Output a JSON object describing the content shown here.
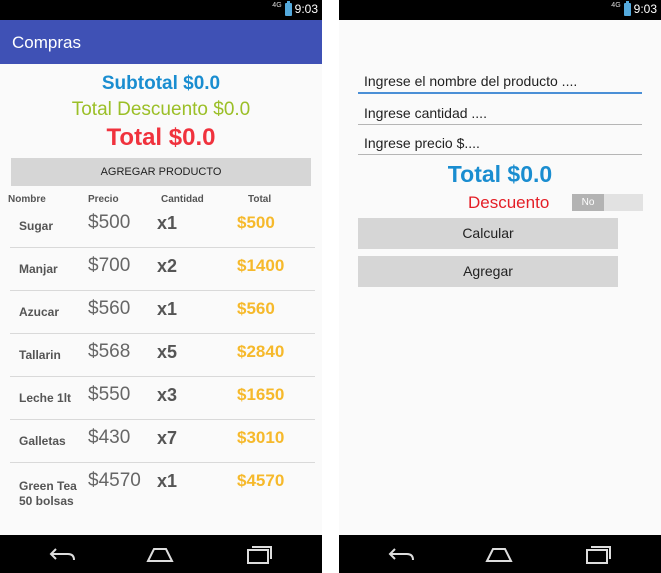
{
  "status": {
    "network": "4G",
    "time": "9:03"
  },
  "left": {
    "app_title": "Compras",
    "subtotal": "Subtotal $0.0",
    "total_descuento": "Total Descuento $0.0",
    "total": "Total $0.0",
    "add_product_button": "AGREGAR PRODUCTO",
    "columns": [
      "Nombre",
      "Precio",
      "Cantidad",
      "Total"
    ],
    "rows": [
      {
        "name": "Sugar",
        "price": "$500",
        "qty": "x1",
        "total": "$500"
      },
      {
        "name": "Manjar",
        "price": "$700",
        "qty": "x2",
        "total": "$1400"
      },
      {
        "name": "Azucar",
        "price": "$560",
        "qty": "x1",
        "total": "$560"
      },
      {
        "name": "Tallarin",
        "price": "$568",
        "qty": "x5",
        "total": "$2840"
      },
      {
        "name": "Leche 1lt",
        "price": "$550",
        "qty": "x3",
        "total": "$1650"
      },
      {
        "name": "Galletas",
        "price": "$430",
        "qty": "x7",
        "total": "$3010"
      },
      {
        "name": "Green Tea 50 bolsas",
        "price": "$4570",
        "qty": "x1",
        "total": "$4570"
      }
    ]
  },
  "right": {
    "product_name_placeholder": "Ingrese el nombre del producto ....",
    "quantity_placeholder": "Ingrese cantidad ....",
    "price_placeholder": "Ingrese precio $....",
    "total": "Total $0.0",
    "descuento_label": "Descuento",
    "descuento_toggle": "No",
    "calcular_button": "Calcular",
    "agregar_button": "Agregar"
  },
  "colors": {
    "appbar": "#3f51b5",
    "subtotal": "#1a8dd0",
    "descuento": "#9bbf27",
    "total": "#f0323d",
    "row_total": "#f6b92b"
  },
  "icons": [
    "battery-icon",
    "back-icon",
    "home-icon",
    "recents-icon"
  ]
}
